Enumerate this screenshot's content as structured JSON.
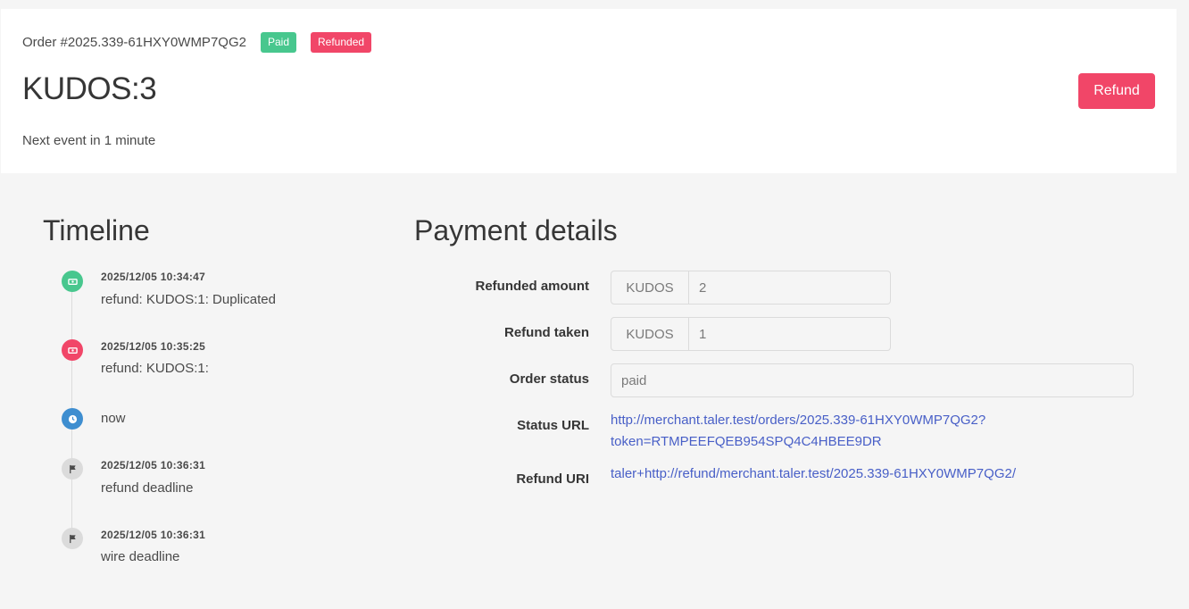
{
  "order": {
    "label": "Order #2025.339-61HXY0WMP7QG2",
    "tags": {
      "paid": "Paid",
      "refunded": "Refunded"
    },
    "amount": "KUDOS:3",
    "refund_button": "Refund",
    "next_event": "Next event in 1 minute"
  },
  "timeline": {
    "title": "Timeline",
    "events": [
      {
        "date": "2025/12/05 10:34:47",
        "text": "refund: KUDOS:1: Duplicated",
        "icon": "refund-icon"
      },
      {
        "date": "2025/12/05 10:35:25",
        "text": "refund: KUDOS:1:",
        "icon": "refund-icon"
      },
      {
        "date": "",
        "text": "now",
        "icon": "clock-icon"
      },
      {
        "date": "2025/12/05 10:36:31",
        "text": "refund deadline",
        "icon": "flag-icon"
      },
      {
        "date": "2025/12/05 10:36:31",
        "text": "wire deadline",
        "icon": "flag-icon"
      }
    ]
  },
  "payment": {
    "title": "Payment details",
    "refunded_amount": {
      "label": "Refunded amount",
      "currency": "KUDOS",
      "value": "2"
    },
    "refund_taken": {
      "label": "Refund taken",
      "currency": "KUDOS",
      "value": "1"
    },
    "order_status": {
      "label": "Order status",
      "value": "paid"
    },
    "status_url": {
      "label": "Status URL",
      "line1": "http://merchant.taler.test/orders/2025.339-61HXY0WMP7QG2?",
      "line2": "token=RTMPEEFQEB954SPQ4C4HBEE9DR"
    },
    "refund_uri": {
      "label": "Refund URI",
      "value": "taler+http://refund/merchant.taler.test/2025.339-61HXY0WMP7QG2/"
    }
  },
  "colors": {
    "success": "#48c78e",
    "danger": "#f14668",
    "info": "#3e8ed0",
    "link": "#485fc7"
  }
}
